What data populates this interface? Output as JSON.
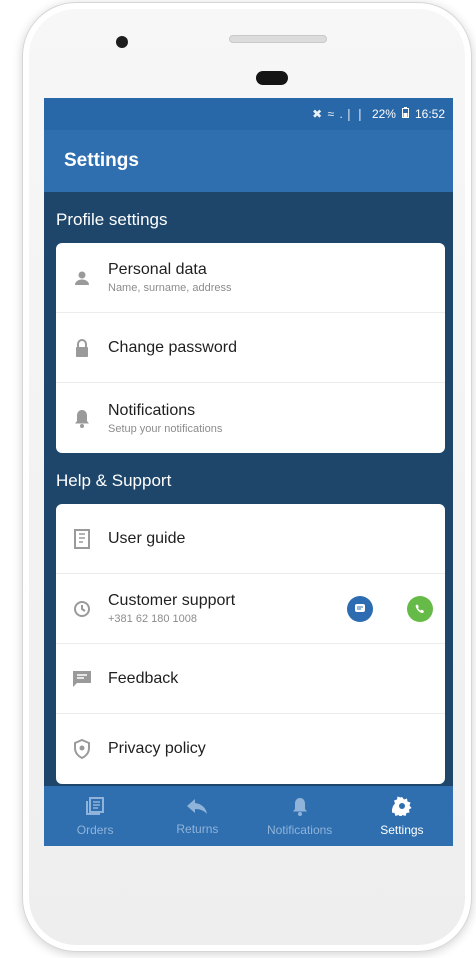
{
  "status_bar": {
    "icons": "✖ ≈ .❘❘",
    "battery": "22%",
    "time": "16:52"
  },
  "app_bar": {
    "title": "Settings"
  },
  "profile_section": {
    "title": "Profile settings",
    "items": [
      {
        "title": "Personal data",
        "subtitle": "Name, surname, address",
        "icon": "person-icon"
      },
      {
        "title": "Change password",
        "icon": "lock-icon"
      },
      {
        "title": "Notifications",
        "subtitle": "Setup your notifications",
        "icon": "bell-icon"
      }
    ]
  },
  "help_section": {
    "title": "Help & Support",
    "items": [
      {
        "title": "User guide",
        "icon": "book-icon"
      },
      {
        "title": "Customer support",
        "subtitle": "+381 62 180 1008",
        "icon": "headset-icon"
      },
      {
        "title": "Feedback",
        "icon": "feedback-icon"
      },
      {
        "title": "Privacy policy",
        "icon": "shield-icon"
      }
    ]
  },
  "bottom_nav": {
    "items": [
      {
        "label": "Orders",
        "icon": "orders-icon"
      },
      {
        "label": "Returns",
        "icon": "reply-icon"
      },
      {
        "label": "Notifications",
        "icon": "bell-icon"
      },
      {
        "label": "Settings",
        "icon": "gear-icon",
        "active": true
      }
    ]
  },
  "colors": {
    "primary": "#2f6fb0",
    "background": "#1e466b",
    "chat": "#2d6cb1",
    "call": "#66bb48"
  }
}
